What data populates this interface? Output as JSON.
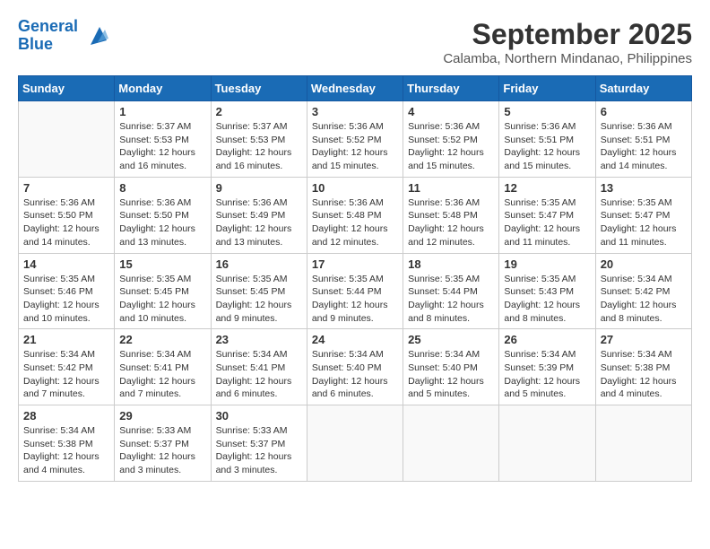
{
  "logo": {
    "line1": "General",
    "line2": "Blue"
  },
  "title": "September 2025",
  "location": "Calamba, Northern Mindanao, Philippines",
  "weekdays": [
    "Sunday",
    "Monday",
    "Tuesday",
    "Wednesday",
    "Thursday",
    "Friday",
    "Saturday"
  ],
  "weeks": [
    [
      {
        "day": "",
        "info": ""
      },
      {
        "day": "1",
        "info": "Sunrise: 5:37 AM\nSunset: 5:53 PM\nDaylight: 12 hours\nand 16 minutes."
      },
      {
        "day": "2",
        "info": "Sunrise: 5:37 AM\nSunset: 5:53 PM\nDaylight: 12 hours\nand 16 minutes."
      },
      {
        "day": "3",
        "info": "Sunrise: 5:36 AM\nSunset: 5:52 PM\nDaylight: 12 hours\nand 15 minutes."
      },
      {
        "day": "4",
        "info": "Sunrise: 5:36 AM\nSunset: 5:52 PM\nDaylight: 12 hours\nand 15 minutes."
      },
      {
        "day": "5",
        "info": "Sunrise: 5:36 AM\nSunset: 5:51 PM\nDaylight: 12 hours\nand 15 minutes."
      },
      {
        "day": "6",
        "info": "Sunrise: 5:36 AM\nSunset: 5:51 PM\nDaylight: 12 hours\nand 14 minutes."
      }
    ],
    [
      {
        "day": "7",
        "info": "Sunrise: 5:36 AM\nSunset: 5:50 PM\nDaylight: 12 hours\nand 14 minutes."
      },
      {
        "day": "8",
        "info": "Sunrise: 5:36 AM\nSunset: 5:50 PM\nDaylight: 12 hours\nand 13 minutes."
      },
      {
        "day": "9",
        "info": "Sunrise: 5:36 AM\nSunset: 5:49 PM\nDaylight: 12 hours\nand 13 minutes."
      },
      {
        "day": "10",
        "info": "Sunrise: 5:36 AM\nSunset: 5:48 PM\nDaylight: 12 hours\nand 12 minutes."
      },
      {
        "day": "11",
        "info": "Sunrise: 5:36 AM\nSunset: 5:48 PM\nDaylight: 12 hours\nand 12 minutes."
      },
      {
        "day": "12",
        "info": "Sunrise: 5:35 AM\nSunset: 5:47 PM\nDaylight: 12 hours\nand 11 minutes."
      },
      {
        "day": "13",
        "info": "Sunrise: 5:35 AM\nSunset: 5:47 PM\nDaylight: 12 hours\nand 11 minutes."
      }
    ],
    [
      {
        "day": "14",
        "info": "Sunrise: 5:35 AM\nSunset: 5:46 PM\nDaylight: 12 hours\nand 10 minutes."
      },
      {
        "day": "15",
        "info": "Sunrise: 5:35 AM\nSunset: 5:45 PM\nDaylight: 12 hours\nand 10 minutes."
      },
      {
        "day": "16",
        "info": "Sunrise: 5:35 AM\nSunset: 5:45 PM\nDaylight: 12 hours\nand 9 minutes."
      },
      {
        "day": "17",
        "info": "Sunrise: 5:35 AM\nSunset: 5:44 PM\nDaylight: 12 hours\nand 9 minutes."
      },
      {
        "day": "18",
        "info": "Sunrise: 5:35 AM\nSunset: 5:44 PM\nDaylight: 12 hours\nand 8 minutes."
      },
      {
        "day": "19",
        "info": "Sunrise: 5:35 AM\nSunset: 5:43 PM\nDaylight: 12 hours\nand 8 minutes."
      },
      {
        "day": "20",
        "info": "Sunrise: 5:34 AM\nSunset: 5:42 PM\nDaylight: 12 hours\nand 8 minutes."
      }
    ],
    [
      {
        "day": "21",
        "info": "Sunrise: 5:34 AM\nSunset: 5:42 PM\nDaylight: 12 hours\nand 7 minutes."
      },
      {
        "day": "22",
        "info": "Sunrise: 5:34 AM\nSunset: 5:41 PM\nDaylight: 12 hours\nand 7 minutes."
      },
      {
        "day": "23",
        "info": "Sunrise: 5:34 AM\nSunset: 5:41 PM\nDaylight: 12 hours\nand 6 minutes."
      },
      {
        "day": "24",
        "info": "Sunrise: 5:34 AM\nSunset: 5:40 PM\nDaylight: 12 hours\nand 6 minutes."
      },
      {
        "day": "25",
        "info": "Sunrise: 5:34 AM\nSunset: 5:40 PM\nDaylight: 12 hours\nand 5 minutes."
      },
      {
        "day": "26",
        "info": "Sunrise: 5:34 AM\nSunset: 5:39 PM\nDaylight: 12 hours\nand 5 minutes."
      },
      {
        "day": "27",
        "info": "Sunrise: 5:34 AM\nSunset: 5:38 PM\nDaylight: 12 hours\nand 4 minutes."
      }
    ],
    [
      {
        "day": "28",
        "info": "Sunrise: 5:34 AM\nSunset: 5:38 PM\nDaylight: 12 hours\nand 4 minutes."
      },
      {
        "day": "29",
        "info": "Sunrise: 5:33 AM\nSunset: 5:37 PM\nDaylight: 12 hours\nand 3 minutes."
      },
      {
        "day": "30",
        "info": "Sunrise: 5:33 AM\nSunset: 5:37 PM\nDaylight: 12 hours\nand 3 minutes."
      },
      {
        "day": "",
        "info": ""
      },
      {
        "day": "",
        "info": ""
      },
      {
        "day": "",
        "info": ""
      },
      {
        "day": "",
        "info": ""
      }
    ]
  ]
}
